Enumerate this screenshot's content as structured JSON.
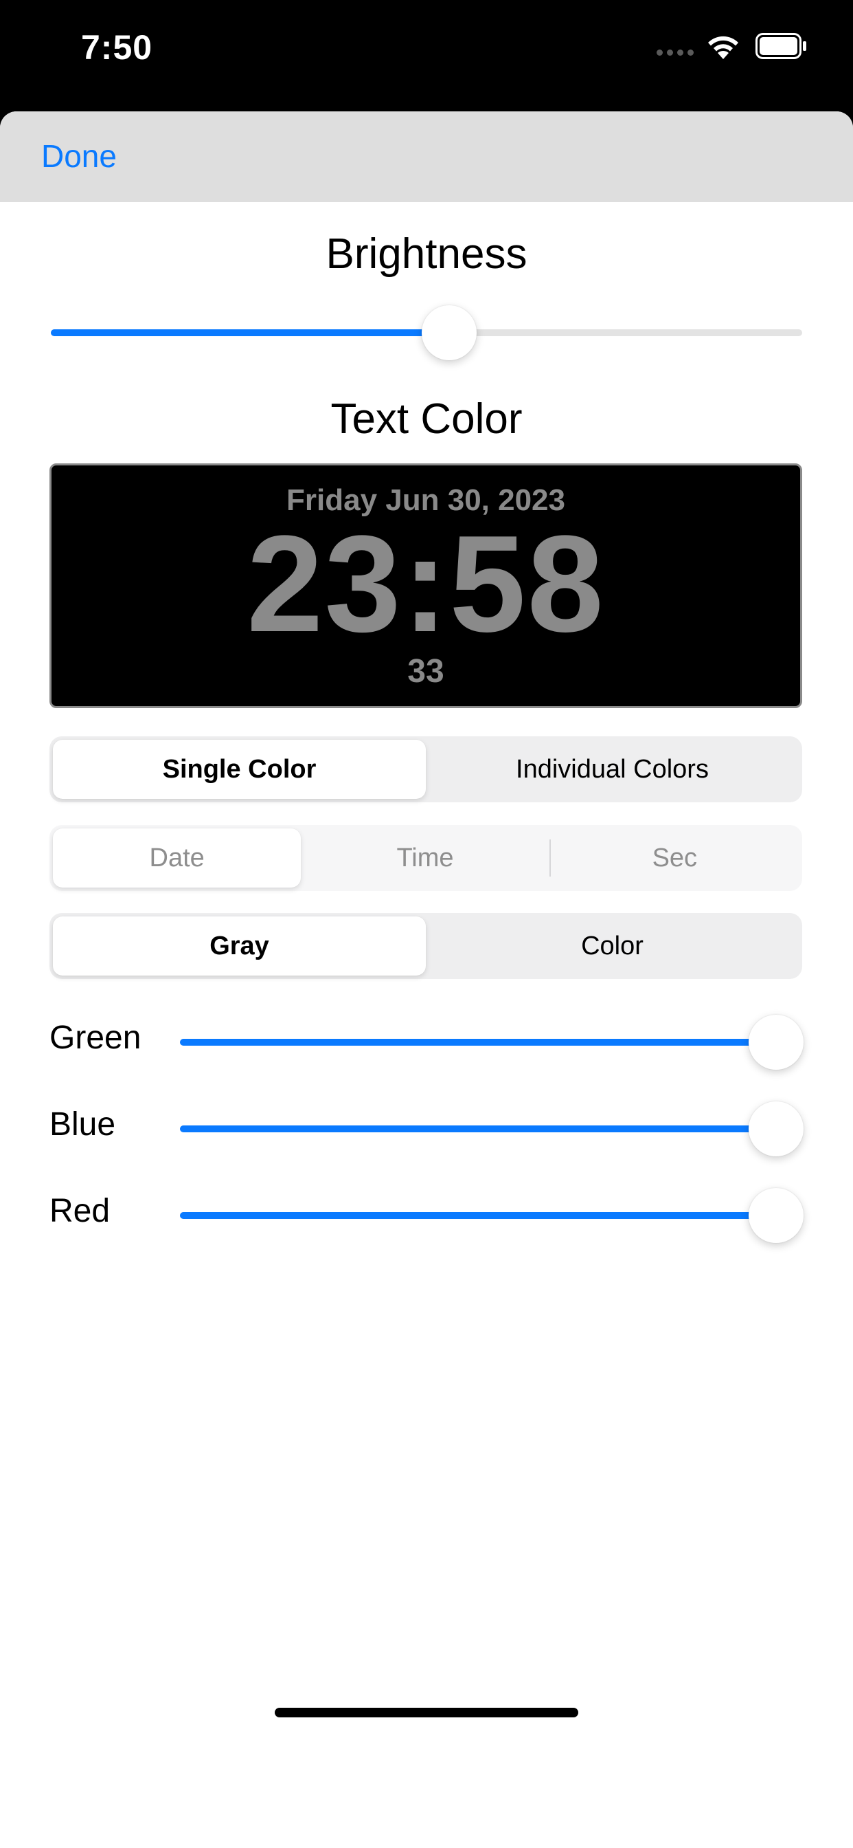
{
  "status_bar": {
    "time": "7:50",
    "icons": [
      "signal-dots-icon",
      "wifi-icon",
      "battery-icon"
    ]
  },
  "header": {
    "done_label": "Done"
  },
  "brightness": {
    "title": "Brightness",
    "value_fraction": 0.53
  },
  "text_color": {
    "title": "Text Color"
  },
  "clock_preview": {
    "date": "Friday Jun 30, 2023",
    "time": "23:58",
    "seconds": "33",
    "text_color": "#8a8a8a",
    "background": "#000000"
  },
  "color_mode": {
    "options": [
      "Single Color",
      "Individual Colors"
    ],
    "selected": "Single Color"
  },
  "component_select": {
    "options": [
      "Date",
      "Time",
      "Sec"
    ],
    "selected": "Date",
    "enabled": false
  },
  "palette_mode": {
    "options": [
      "Gray",
      "Color"
    ],
    "selected": "Gray"
  },
  "rgb_sliders": [
    {
      "label": "Green",
      "value_fraction": 1.0
    },
    {
      "label": "Blue",
      "value_fraction": 1.0
    },
    {
      "label": "Red",
      "value_fraction": 1.0
    }
  ],
  "colors": {
    "accent": "#0a7aff",
    "header_bg": "#dedede",
    "track": "#e3e3e3"
  }
}
